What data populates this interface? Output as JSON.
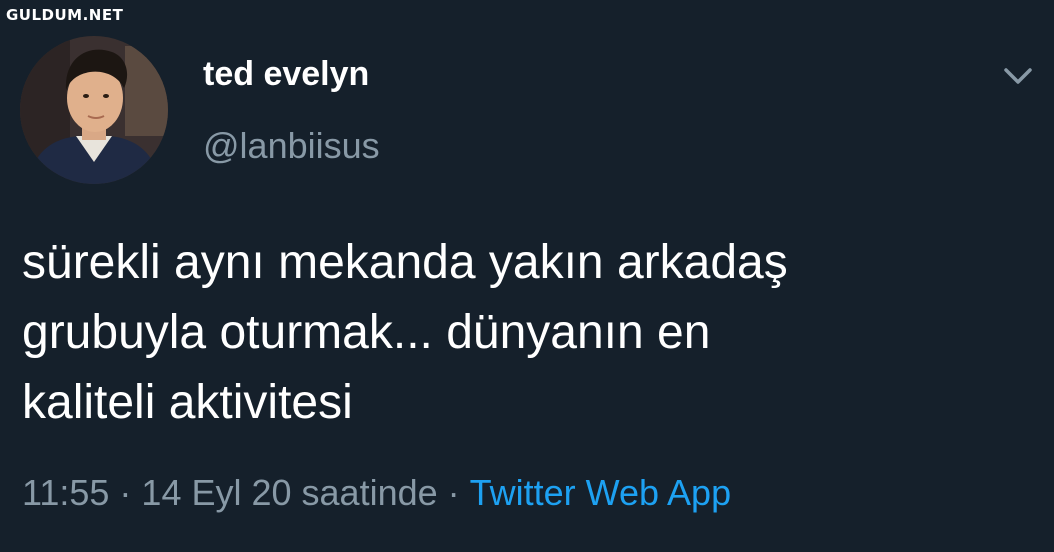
{
  "watermark": "GULDUM.NET",
  "tweet": {
    "author_name": "ted evelyn",
    "author_handle": "@lanbiisus",
    "text": "sürekli aynı mekanda yakın arkadaş\ngrubuyla oturmak... dünyanın en\nkaliteli aktivitesi",
    "time": "11:55",
    "date_text": "14 Eyl 20 saatinde",
    "separator": "·",
    "source": "Twitter Web App",
    "menu_icon": "chevron-down-icon"
  },
  "colors": {
    "background": "#15202b",
    "primary_text": "#ffffff",
    "secondary_text": "#8899a6",
    "accent": "#1da1f2"
  }
}
